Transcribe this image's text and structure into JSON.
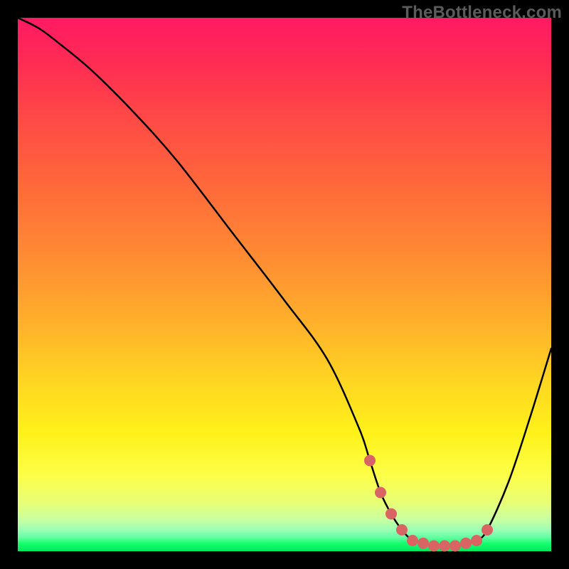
{
  "watermark": "TheBottleneck.com",
  "chart_data": {
    "type": "line",
    "title": "",
    "xlabel": "",
    "ylabel": "",
    "xlim": [
      0,
      100
    ],
    "ylim": [
      0,
      100
    ],
    "grid": false,
    "legend": false,
    "series": [
      {
        "name": "bottleneck-curve",
        "color": "#000000",
        "x": [
          0,
          4,
          8,
          14,
          22,
          30,
          40,
          50,
          58,
          64,
          66,
          68,
          70,
          72,
          74,
          76,
          78,
          80,
          82,
          84,
          86,
          88,
          92,
          96,
          100
        ],
        "y": [
          100,
          98,
          95,
          90,
          82,
          73,
          60,
          47,
          36,
          23,
          17,
          11,
          7,
          4,
          2,
          1.5,
          1,
          1,
          1,
          1.5,
          2,
          4,
          13,
          25,
          38
        ]
      }
    ],
    "scatter": {
      "name": "highlight-dots",
      "color": "#d96464",
      "radius": 8,
      "x": [
        66,
        68,
        70,
        72,
        74,
        76,
        78,
        80,
        82,
        84,
        86,
        88
      ],
      "y": [
        17,
        11,
        7,
        4,
        2,
        1.5,
        1,
        1,
        1,
        1.5,
        2,
        4
      ]
    },
    "gradient_stops": [
      {
        "pos": 0,
        "color": "#ff1a63"
      },
      {
        "pos": 46,
        "color": "#ff8f32"
      },
      {
        "pos": 78,
        "color": "#fff21a"
      },
      {
        "pos": 96,
        "color": "#9dffb5"
      },
      {
        "pos": 100,
        "color": "#00e859"
      }
    ]
  }
}
